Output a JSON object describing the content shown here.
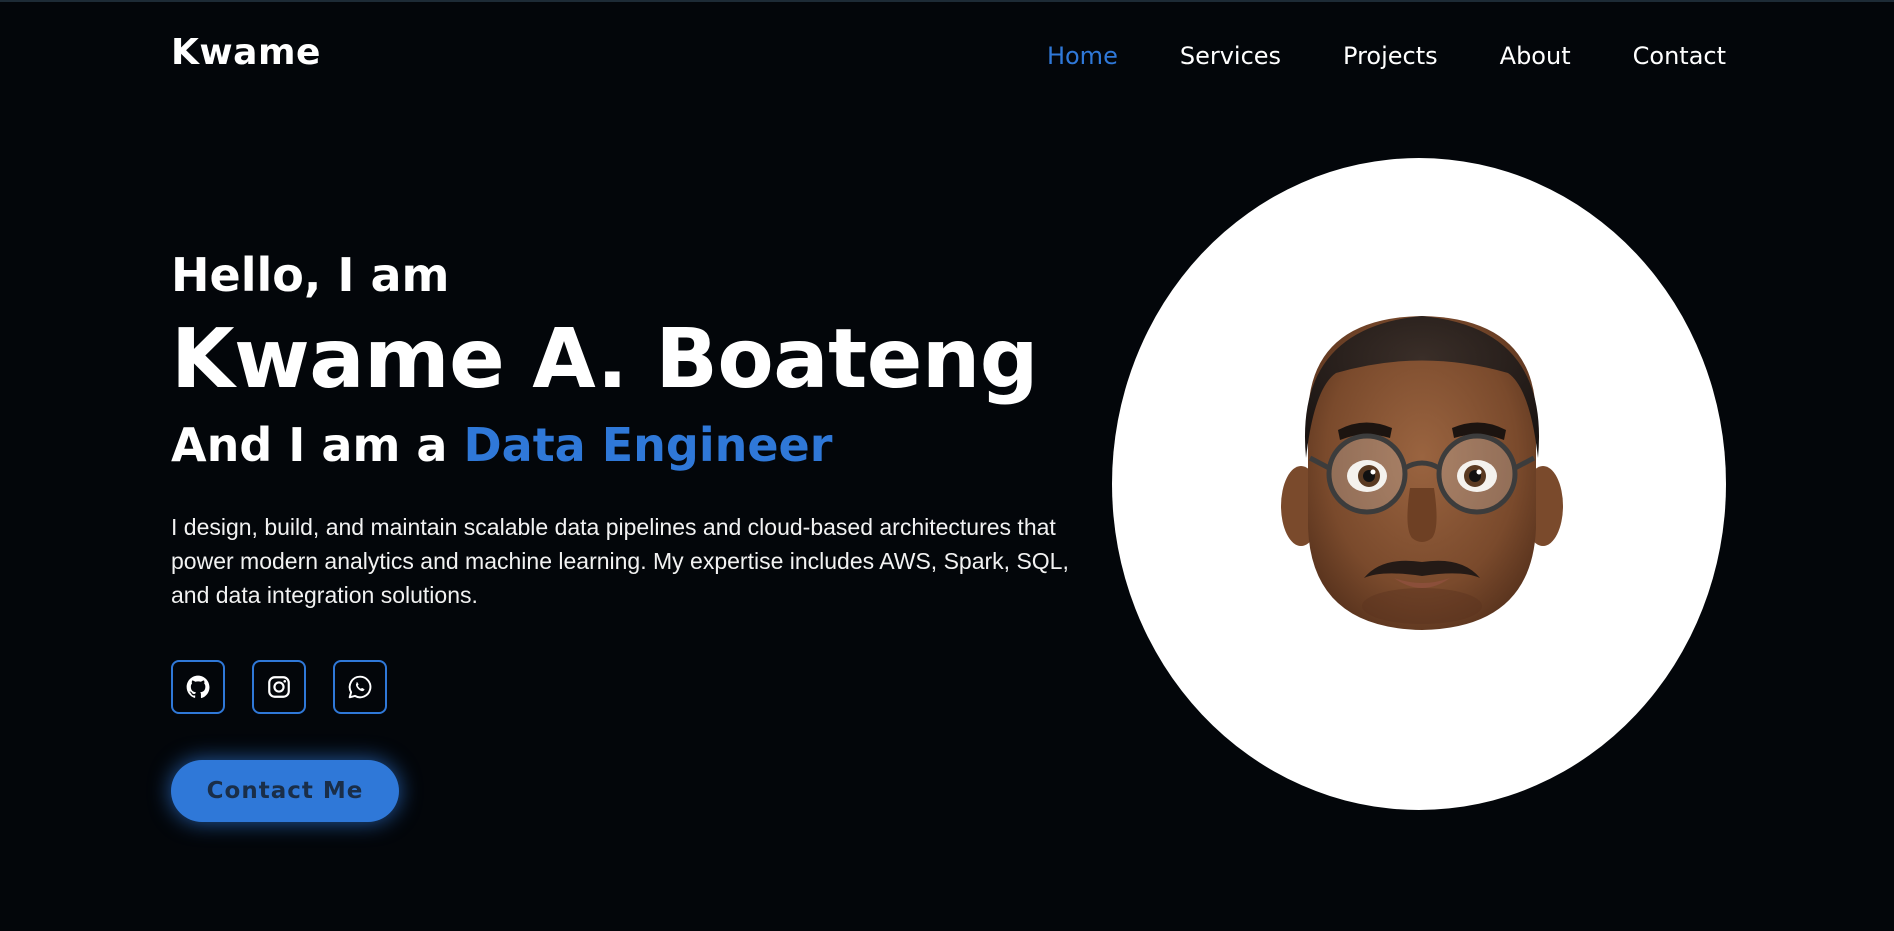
{
  "logo": "Kwame",
  "nav": {
    "items": [
      "Home",
      "Services",
      "Projects",
      "About",
      "Contact"
    ],
    "active": "Home"
  },
  "hero": {
    "greeting": "Hello, I am",
    "name": "Kwame A. Boateng",
    "role_prefix": "And I am a",
    "role": "Data Engineer",
    "description": "I design, build, and maintain scalable data pipelines and cloud-based architectures that power modern analytics and machine learning. My expertise includes AWS, Spark, SQL, and data integration solutions."
  },
  "socials": {
    "icons": [
      "github-icon",
      "instagram-icon",
      "whatsapp-icon"
    ]
  },
  "cta": {
    "label": "Contact Me"
  },
  "colors": {
    "background": "#03060a",
    "accent": "#2f78d8",
    "text": "#ffffff"
  }
}
